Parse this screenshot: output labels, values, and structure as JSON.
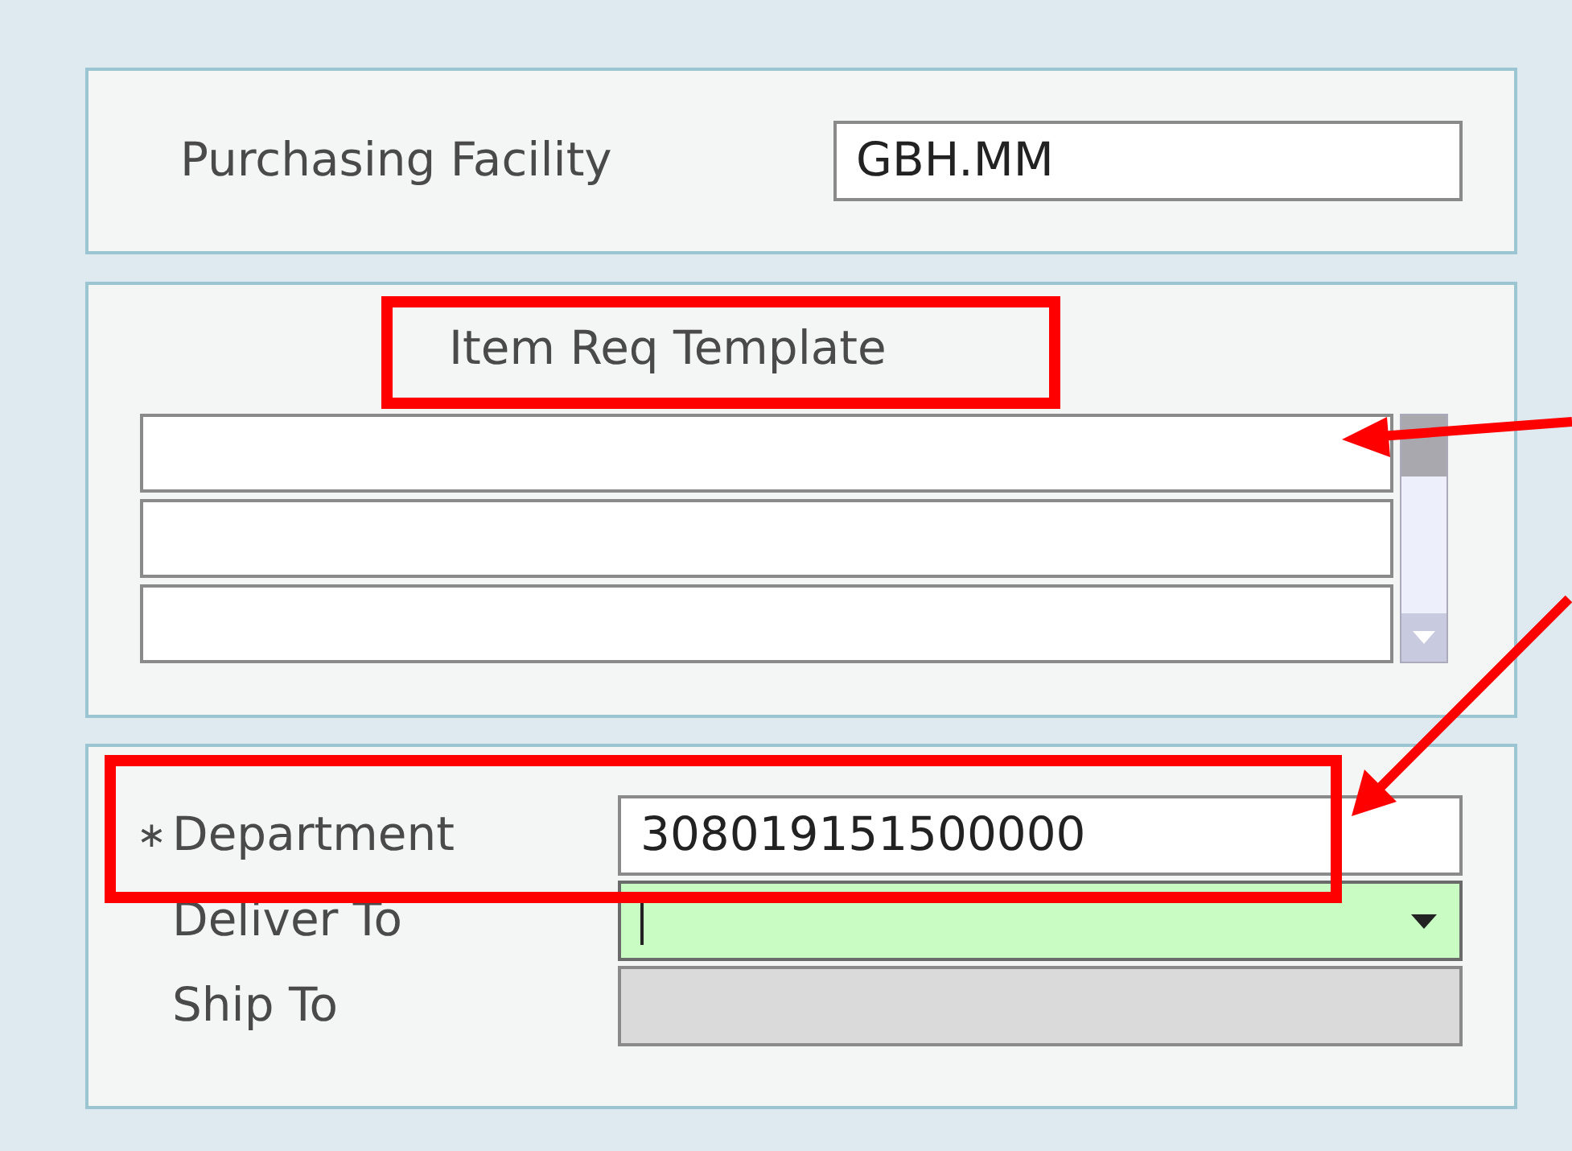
{
  "facility": {
    "label": "Purchasing Facility",
    "value": "GBH.MM"
  },
  "template": {
    "title": "Item Req Template"
  },
  "fields": [
    {
      "kind": "text",
      "label": "Department",
      "required_marker": "∗",
      "value": "308019151500000",
      "focused": false
    },
    {
      "kind": "dropdown",
      "label": "Deliver To",
      "focused": true
    },
    {
      "kind": "readonly",
      "label": "Ship To",
      "focused": false
    }
  ]
}
